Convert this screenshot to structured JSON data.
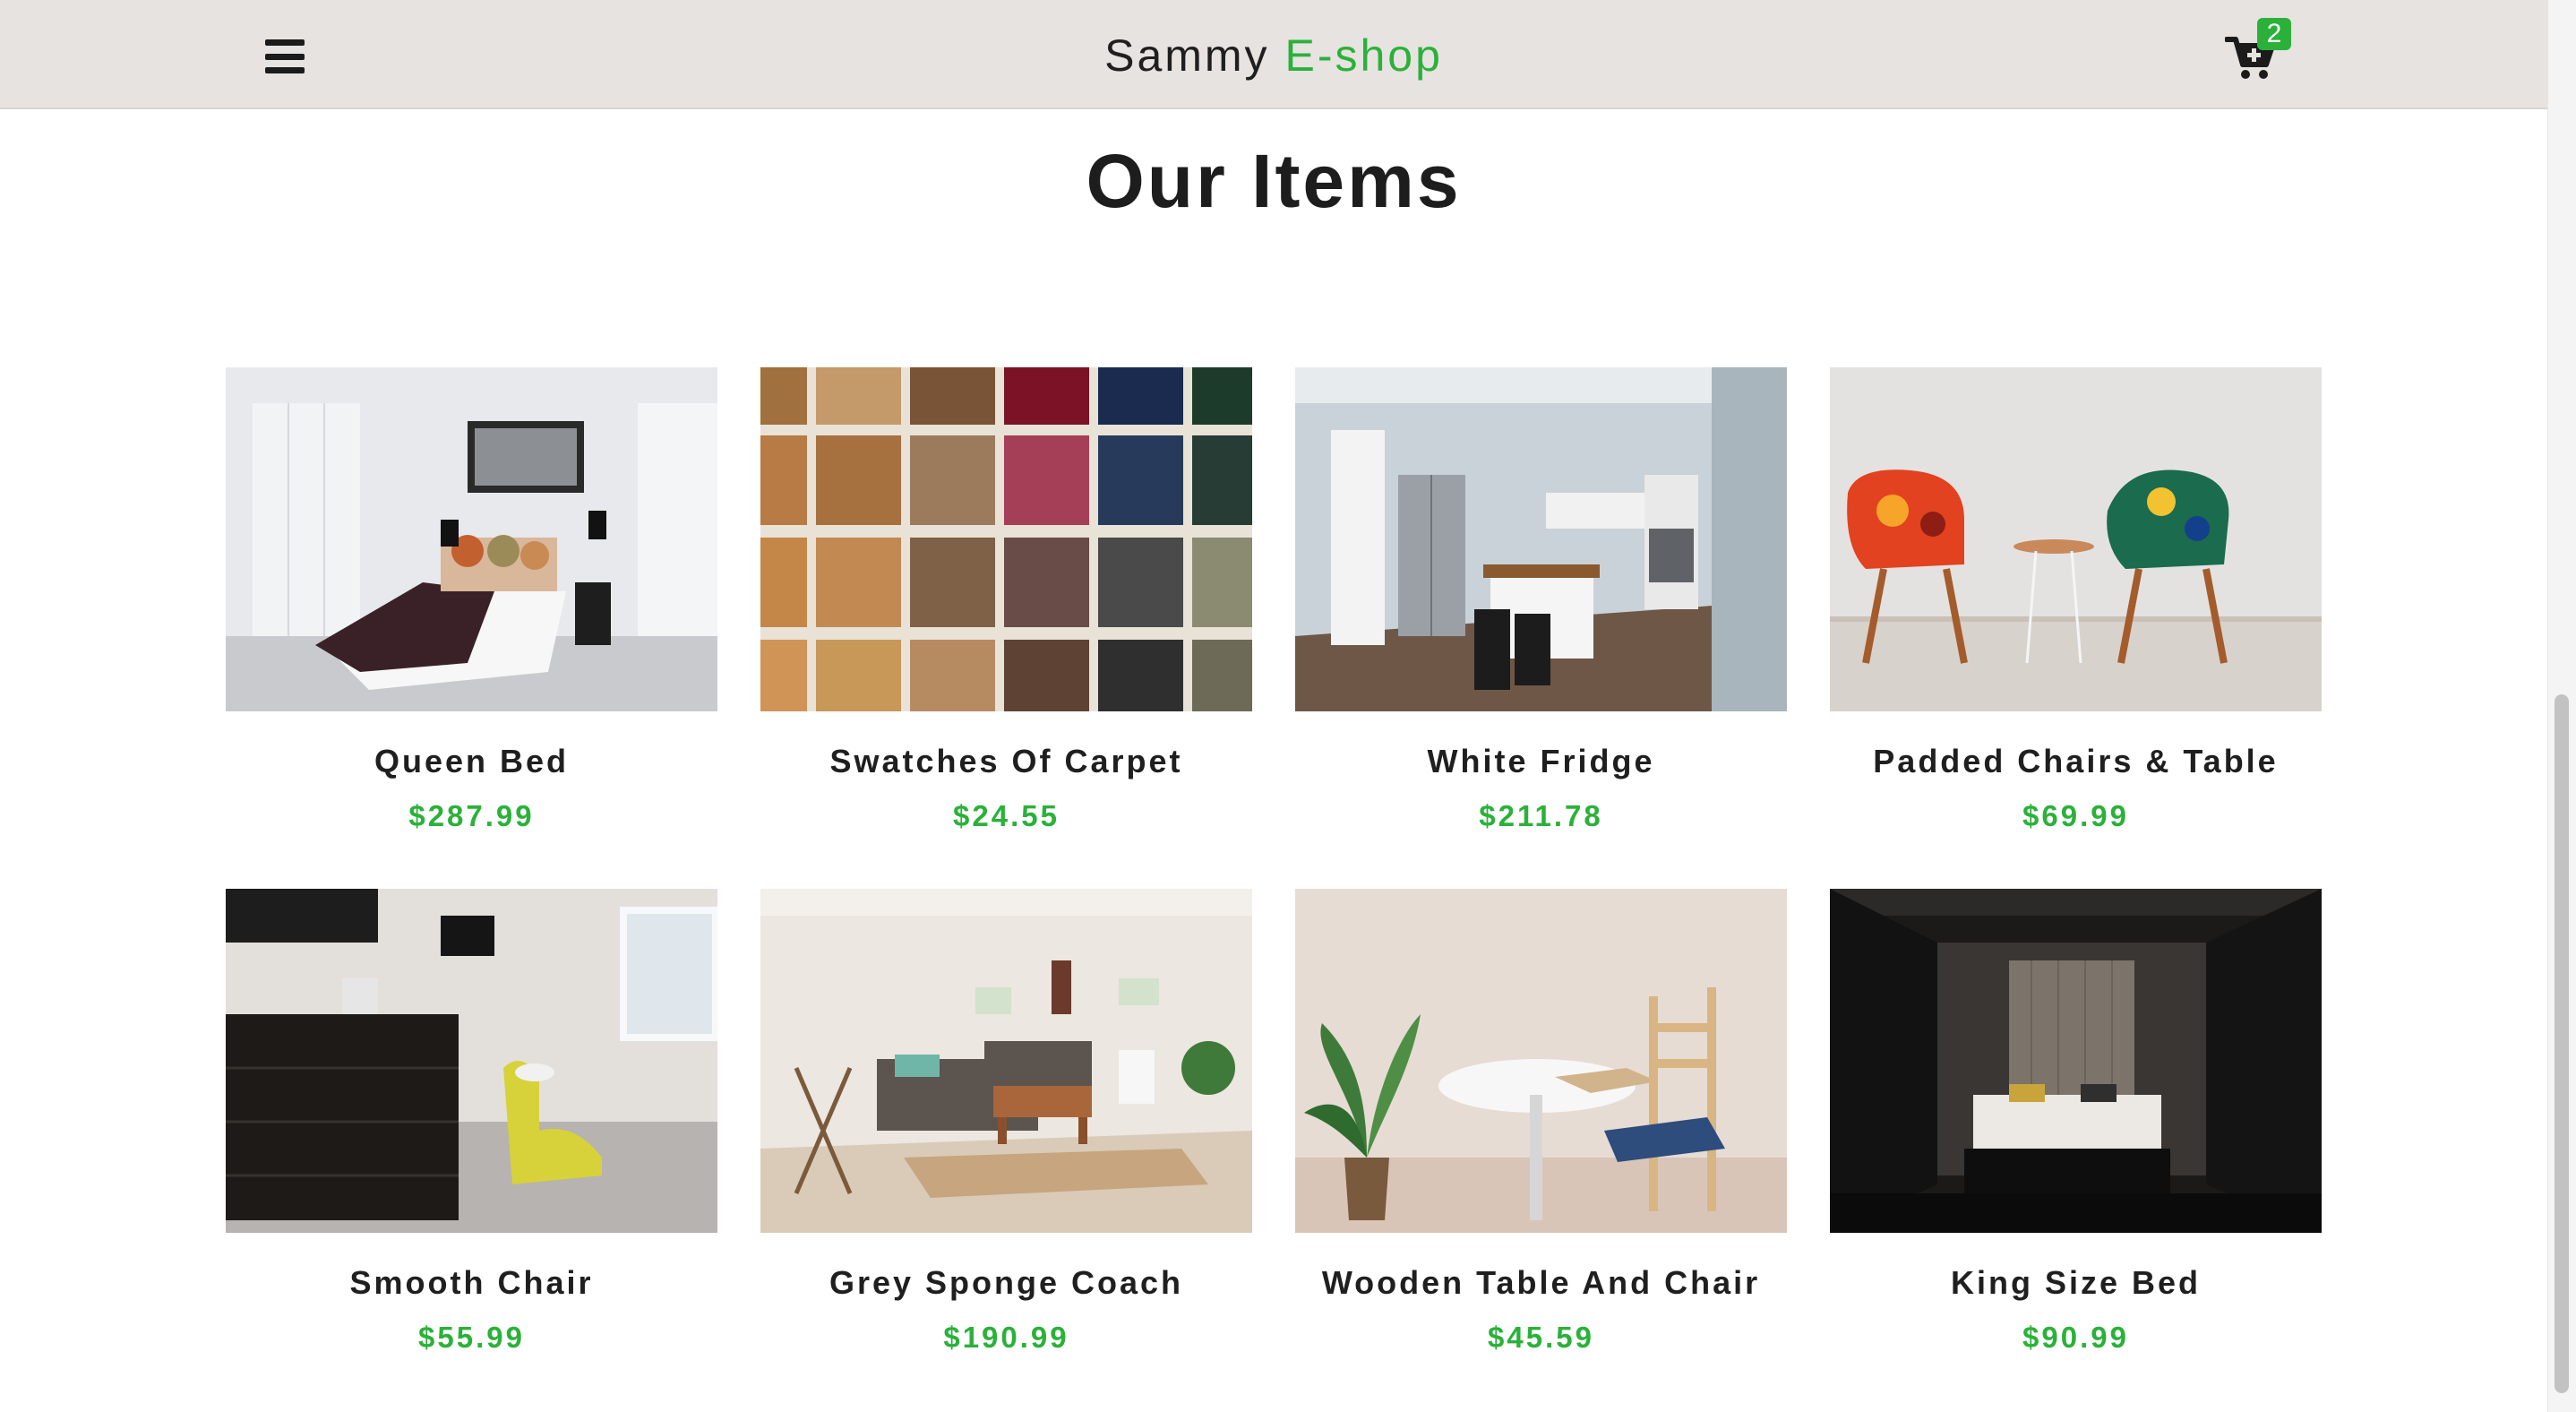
{
  "navbar": {
    "brand_main": "Sammy",
    "brand_accent": "E-shop",
    "menu_icon": "hamburger-menu-icon",
    "cart_icon": "shopping-cart-icon",
    "cart_count": "2"
  },
  "page_title": "Our Items",
  "products": [
    {
      "name": "Queen Bed",
      "price": "$287.99"
    },
    {
      "name": "Swatches Of Carpet",
      "price": "$24.55"
    },
    {
      "name": "White Fridge",
      "price": "$211.78"
    },
    {
      "name": "Padded Chairs & Table",
      "price": "$69.99"
    },
    {
      "name": "Smooth Chair",
      "price": "$55.99"
    },
    {
      "name": "Grey Sponge Coach",
      "price": "$190.99"
    },
    {
      "name": "Wooden Table And Chair",
      "price": "$45.59"
    },
    {
      "name": "King Size Bed",
      "price": "$90.99"
    }
  ],
  "colors": {
    "accent": "#2bb13a",
    "navbar_bg": "#e6e3e0",
    "text": "#1f1f1f"
  }
}
